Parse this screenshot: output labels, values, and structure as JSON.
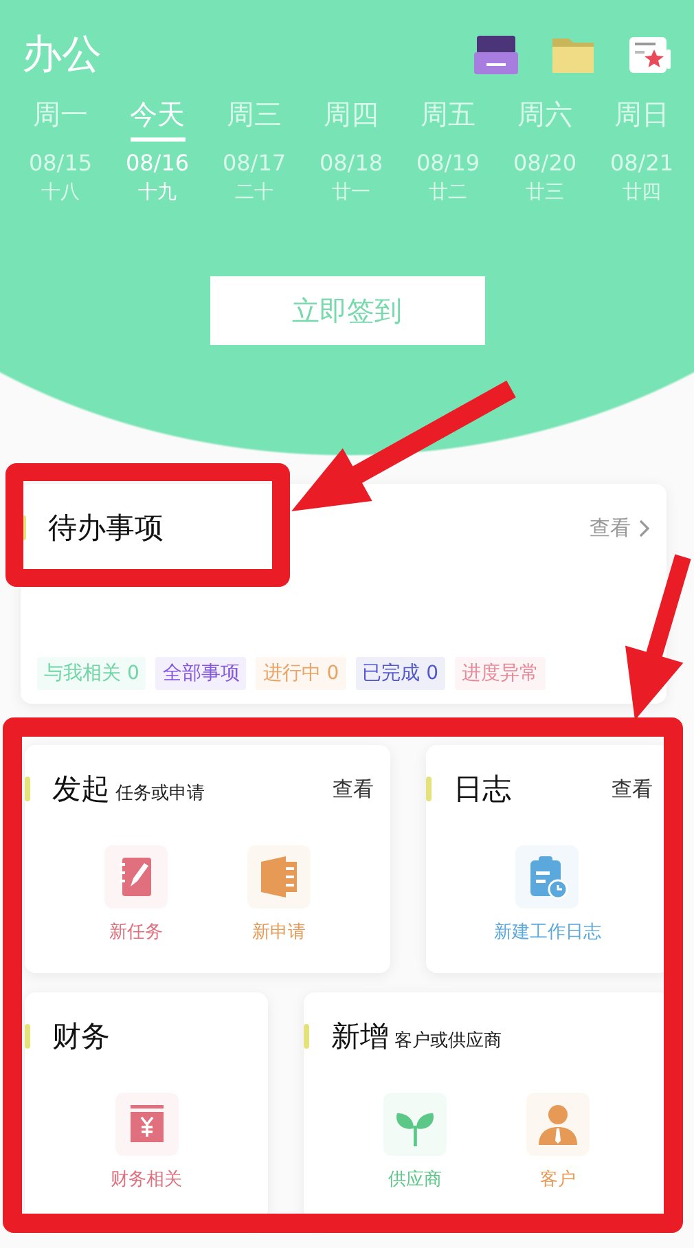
{
  "header": {
    "title": "办公"
  },
  "week": [
    {
      "weekday": "周一",
      "date": "08/15",
      "lunar": "十八",
      "selected": false
    },
    {
      "weekday": "今天",
      "date": "08/16",
      "lunar": "十九",
      "selected": true
    },
    {
      "weekday": "周三",
      "date": "08/17",
      "lunar": "二十",
      "selected": false
    },
    {
      "weekday": "周四",
      "date": "08/18",
      "lunar": "廿一",
      "selected": false
    },
    {
      "weekday": "周五",
      "date": "08/19",
      "lunar": "廿二",
      "selected": false
    },
    {
      "weekday": "周六",
      "date": "08/20",
      "lunar": "廿三",
      "selected": false
    },
    {
      "weekday": "周日",
      "date": "08/21",
      "lunar": "廿四",
      "selected": false
    }
  ],
  "checkin_button": "立即签到",
  "todo": {
    "title": "待办事项",
    "view_link": "查看",
    "tags": [
      {
        "label": "与我相关 0",
        "color": "#6fd6a6"
      },
      {
        "label": "全部事项",
        "color": "#8458e0"
      },
      {
        "label": "进行中 0",
        "color": "#e8a365"
      },
      {
        "label": "已完成 0",
        "color": "#5257cc"
      },
      {
        "label": "进度异常",
        "color": "#e8899a"
      }
    ]
  },
  "panel_rows": [
    [
      {
        "title": "发起",
        "subtitle": "任务或申请",
        "view_link": "查看",
        "actions": [
          {
            "label": "新任务",
            "kind": "task",
            "color": "#e0707e"
          },
          {
            "label": "新申请",
            "kind": "application",
            "color": "#e79a55"
          }
        ]
      },
      {
        "title": "日志",
        "view_link": "查看",
        "actions": [
          {
            "label": "新建工作日志",
            "kind": "log",
            "color": "#5aa8dc"
          }
        ]
      }
    ],
    [
      {
        "title": "财务",
        "actions": [
          {
            "label": "财务相关",
            "kind": "finance",
            "color": "#e0707e"
          }
        ]
      },
      {
        "title": "新增",
        "subtitle": "客户或供应商",
        "actions": [
          {
            "label": "供应商",
            "kind": "supplier",
            "color": "#5cc888"
          },
          {
            "label": "客户",
            "kind": "customer",
            "color": "#e79a55"
          }
        ]
      }
    ]
  ]
}
